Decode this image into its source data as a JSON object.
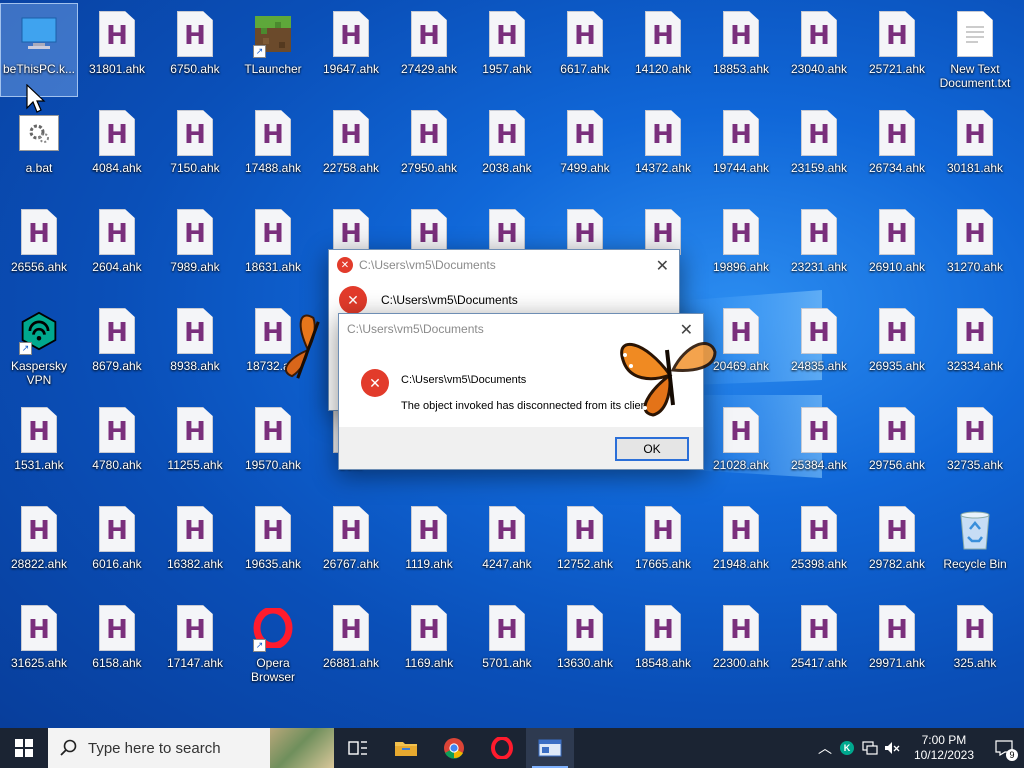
{
  "desktop": {
    "icons": [
      {
        "label": "beThisPC.k...",
        "type": "thispc"
      },
      {
        "label": "31801.ahk",
        "type": "ahk"
      },
      {
        "label": "6750.ahk",
        "type": "ahk"
      },
      {
        "label": "TLauncher",
        "type": "tlauncher"
      },
      {
        "label": "19647.ahk",
        "type": "ahk"
      },
      {
        "label": "27429.ahk",
        "type": "ahk"
      },
      {
        "label": "1957.ahk",
        "type": "ahk"
      },
      {
        "label": "6617.ahk",
        "type": "ahk"
      },
      {
        "label": "14120.ahk",
        "type": "ahk"
      },
      {
        "label": "18853.ahk",
        "type": "ahk"
      },
      {
        "label": "23040.ahk",
        "type": "ahk"
      },
      {
        "label": "25721.ahk",
        "type": "ahk"
      },
      {
        "label": "New Text Document.txt",
        "type": "txt"
      },
      {
        "label": "a.bat",
        "type": "bat"
      },
      {
        "label": "4084.ahk",
        "type": "ahk"
      },
      {
        "label": "7150.ahk",
        "type": "ahk"
      },
      {
        "label": "17488.ahk",
        "type": "ahk"
      },
      {
        "label": "22758.ahk",
        "type": "ahk"
      },
      {
        "label": "27950.ahk",
        "type": "ahk"
      },
      {
        "label": "2038.ahk",
        "type": "ahk"
      },
      {
        "label": "7499.ahk",
        "type": "ahk"
      },
      {
        "label": "14372.ahk",
        "type": "ahk"
      },
      {
        "label": "19744.ahk",
        "type": "ahk"
      },
      {
        "label": "23159.ahk",
        "type": "ahk"
      },
      {
        "label": "26734.ahk",
        "type": "ahk"
      },
      {
        "label": "30181.ahk",
        "type": "ahk"
      },
      {
        "label": "26556.ahk",
        "type": "ahk"
      },
      {
        "label": "2604.ahk",
        "type": "ahk"
      },
      {
        "label": "7989.ahk",
        "type": "ahk"
      },
      {
        "label": "18631.ahk",
        "type": "ahk"
      },
      {
        "label": "",
        "type": "ahk"
      },
      {
        "label": "",
        "type": "ahk"
      },
      {
        "label": "",
        "type": "ahk"
      },
      {
        "label": "",
        "type": "ahk"
      },
      {
        "label": "",
        "type": "ahk"
      },
      {
        "label": "19896.ahk",
        "type": "ahk"
      },
      {
        "label": "23231.ahk",
        "type": "ahk"
      },
      {
        "label": "26910.ahk",
        "type": "ahk"
      },
      {
        "label": "31270.ahk",
        "type": "ahk"
      },
      {
        "label": "Kaspersky VPN",
        "type": "kaspersky"
      },
      {
        "label": "8679.ahk",
        "type": "ahk"
      },
      {
        "label": "8938.ahk",
        "type": "ahk"
      },
      {
        "label": "18732.a...",
        "type": "ahk"
      },
      {
        "label": "",
        "type": "none"
      },
      {
        "label": "",
        "type": "none"
      },
      {
        "label": "",
        "type": "none"
      },
      {
        "label": "",
        "type": "none"
      },
      {
        "label": "",
        "type": "none"
      },
      {
        "label": "20469.ahk",
        "type": "ahk"
      },
      {
        "label": "24835.ahk",
        "type": "ahk"
      },
      {
        "label": "26935.ahk",
        "type": "ahk"
      },
      {
        "label": "32334.ahk",
        "type": "ahk"
      },
      {
        "label": "1531.ahk",
        "type": "ahk"
      },
      {
        "label": "4780.ahk",
        "type": "ahk"
      },
      {
        "label": "11255.ahk",
        "type": "ahk"
      },
      {
        "label": "19570.ahk",
        "type": "ahk"
      },
      {
        "label": "26...",
        "type": "ahk"
      },
      {
        "label": "",
        "type": "none"
      },
      {
        "label": "",
        "type": "none"
      },
      {
        "label": "",
        "type": "none"
      },
      {
        "label": "",
        "type": "none"
      },
      {
        "label": "21028.ahk",
        "type": "ahk"
      },
      {
        "label": "25384.ahk",
        "type": "ahk"
      },
      {
        "label": "29756.ahk",
        "type": "ahk"
      },
      {
        "label": "32735.ahk",
        "type": "ahk"
      },
      {
        "label": "28822.ahk",
        "type": "ahk"
      },
      {
        "label": "6016.ahk",
        "type": "ahk"
      },
      {
        "label": "16382.ahk",
        "type": "ahk"
      },
      {
        "label": "19635.ahk",
        "type": "ahk"
      },
      {
        "label": "26767.ahk",
        "type": "ahk"
      },
      {
        "label": "1119.ahk",
        "type": "ahk"
      },
      {
        "label": "4247.ahk",
        "type": "ahk"
      },
      {
        "label": "12752.ahk",
        "type": "ahk"
      },
      {
        "label": "17665.ahk",
        "type": "ahk"
      },
      {
        "label": "21948.ahk",
        "type": "ahk"
      },
      {
        "label": "25398.ahk",
        "type": "ahk"
      },
      {
        "label": "29782.ahk",
        "type": "ahk"
      },
      {
        "label": "Recycle Bin",
        "type": "recycle"
      },
      {
        "label": "31625.ahk",
        "type": "ahk"
      },
      {
        "label": "6158.ahk",
        "type": "ahk"
      },
      {
        "label": "17147.ahk",
        "type": "ahk"
      },
      {
        "label": "Opera Browser",
        "type": "opera"
      },
      {
        "label": "26881.ahk",
        "type": "ahk"
      },
      {
        "label": "1169.ahk",
        "type": "ahk"
      },
      {
        "label": "5701.ahk",
        "type": "ahk"
      },
      {
        "label": "13630.ahk",
        "type": "ahk"
      },
      {
        "label": "18548.ahk",
        "type": "ahk"
      },
      {
        "label": "22300.ahk",
        "type": "ahk"
      },
      {
        "label": "25417.ahk",
        "type": "ahk"
      },
      {
        "label": "29971.ahk",
        "type": "ahk"
      },
      {
        "label": "325.ahk",
        "type": "ahk"
      }
    ]
  },
  "dialog_back": {
    "title": "C:\\Users\\vm5\\Documents",
    "heading": "C:\\Users\\vm5\\Documents"
  },
  "dialog_front": {
    "title": "C:\\Users\\vm5\\Documents",
    "path": "C:\\Users\\vm5\\Documents",
    "message": "The object invoked has disconnected from its clients.",
    "ok_label": "OK"
  },
  "taskbar": {
    "search_placeholder": "Type here to search",
    "time": "7:00 PM",
    "date": "10/12/2023",
    "notification_count": "9",
    "pinned": [
      "task-view",
      "file-explorer",
      "chrome",
      "opera",
      "app-window"
    ]
  },
  "colors": {
    "wallpaper": "#0a4fb8",
    "taskbar": "#1b2433",
    "error_red": "#e23b2b",
    "ok_focus": "#2b6fd8"
  }
}
